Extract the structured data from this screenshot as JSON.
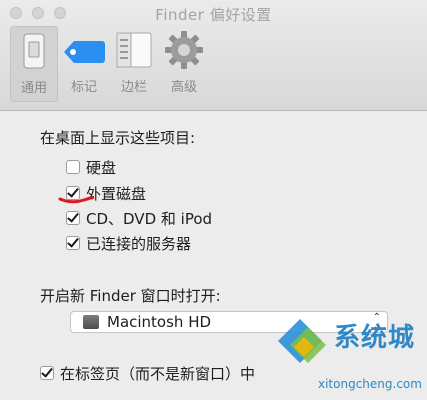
{
  "window": {
    "title": "Finder 偏好设置"
  },
  "toolbar": {
    "items": [
      {
        "label": "通用",
        "icon": "general-switch-icon",
        "selected": true
      },
      {
        "label": "标记",
        "icon": "tag-icon",
        "selected": false
      },
      {
        "label": "边栏",
        "icon": "sidebar-icon",
        "selected": false
      },
      {
        "label": "高级",
        "icon": "gear-icon",
        "selected": false
      }
    ]
  },
  "desktop_section": {
    "title": "在桌面上显示这些项目:",
    "items": [
      {
        "label": "硬盘",
        "checked": false
      },
      {
        "label": "外置磁盘",
        "checked": true
      },
      {
        "label": "CD、DVD 和 iPod",
        "checked": true
      },
      {
        "label": "已连接的服务器",
        "checked": true
      }
    ]
  },
  "new_window_section": {
    "title": "开启新 Finder 窗口时打开:",
    "selected": "Macintosh HD"
  },
  "tabs_option": {
    "label": "在标签页（而不是新窗口）中",
    "checked": true
  },
  "watermark": {
    "brand": "系统城",
    "url": "xitongcheng.com"
  },
  "colors": {
    "accent": "#2f88c8",
    "annotation": "#e0161b",
    "tag": "#2a8ff0"
  }
}
